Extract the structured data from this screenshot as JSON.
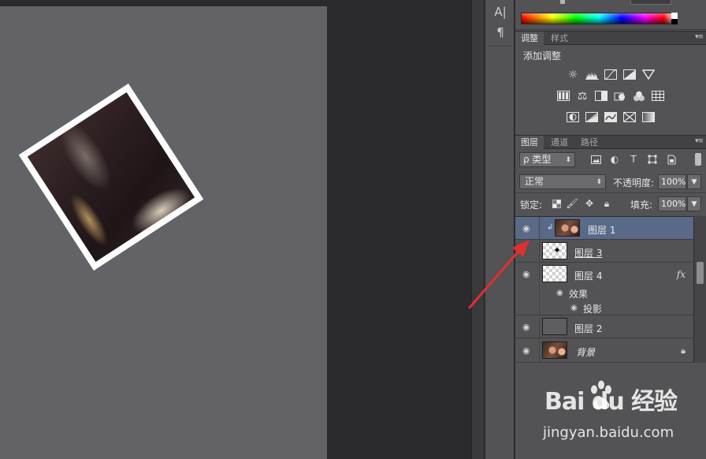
{
  "tools": {
    "type_tool_glyph": "A|",
    "paragraph_glyph": "¶"
  },
  "adjustments_tabs": {
    "adjustments": "调整",
    "styles": "样式"
  },
  "adjustments": {
    "title": "添加调整",
    "row1": [
      "brightness-contrast-icon",
      "levels-icon",
      "curves-icon",
      "exposure-icon",
      "vibrance-icon"
    ],
    "row2": [
      "hue-saturation-icon",
      "color-balance-icon",
      "black-white-icon",
      "photo-filter-icon",
      "channel-mixer-icon",
      "color-lookup-icon"
    ],
    "row3": [
      "invert-icon",
      "posterize-icon",
      "threshold-icon",
      "selective-color-icon",
      "gradient-map-icon"
    ]
  },
  "layers_tabs": {
    "layers": "图层",
    "channels": "通道",
    "paths": "路径"
  },
  "layers_panel": {
    "filter_kind": "ρ 类型",
    "blend_mode": "正常",
    "opacity_label": "不透明度:",
    "opacity_value": "100%",
    "lock_label": "锁定:",
    "fill_label": "填充:",
    "fill_value": "100%",
    "layers": [
      {
        "name": "图层 1",
        "selected": true
      },
      {
        "name": "图层 3"
      },
      {
        "name": "图层 4",
        "fx": "fx"
      },
      {
        "name": "图层 2"
      },
      {
        "name": "背景"
      }
    ],
    "effects_label": "效果",
    "drop_shadow_label": "投影"
  },
  "watermark": {
    "brand": "Bai du 经验",
    "url": "jingyan.baidu.com"
  },
  "colors": {
    "accent_selected_row": "#596a88",
    "arrow": "#e03030"
  }
}
